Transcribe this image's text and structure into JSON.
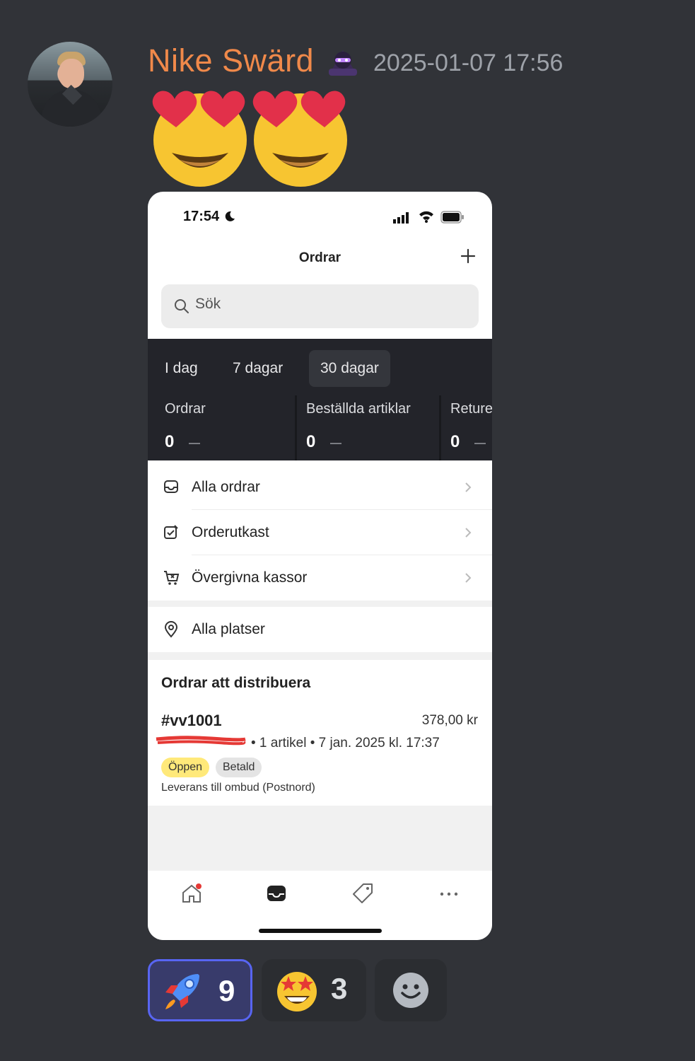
{
  "message": {
    "username": "Nike Swärd",
    "timestamp": "2025-01-07 17:56",
    "big_emojis": [
      "heart-eyes-emoji",
      "heart-eyes-emoji"
    ]
  },
  "phone": {
    "status_time": "17:54",
    "nav_title": "Ordrar",
    "search_placeholder": "Sök",
    "ranges": [
      "I dag",
      "7 dagar",
      "30 dagar"
    ],
    "active_range": "30 dagar",
    "stats": [
      {
        "label": "Ordrar",
        "value": "0"
      },
      {
        "label": "Beställda artiklar",
        "value": "0"
      },
      {
        "label": "Returer",
        "value": "0"
      }
    ],
    "menu": [
      {
        "label": "Alla ordrar",
        "icon": "inbox-icon"
      },
      {
        "label": "Orderutkast",
        "icon": "draft-edit-icon"
      },
      {
        "label": "Övergivna kassor",
        "icon": "abandoned-cart-icon"
      }
    ],
    "locations": {
      "label": "Alla platser",
      "icon": "location-pin-icon"
    },
    "section_title": "Ordrar att distribuera",
    "order": {
      "id": "#vv1001",
      "price": "378,00 kr",
      "meta": "• 1 artikel • 7 jan. 2025 kl. 17:37",
      "badges": [
        "Öppen",
        "Betald"
      ],
      "delivery": "Leverans till ombud (Postnord)"
    },
    "tabbar": [
      "home-icon",
      "orders-icon",
      "tag-icon",
      "more-icon"
    ]
  },
  "reactions": [
    {
      "emoji": "rocket-emoji",
      "count": "9",
      "active": true
    },
    {
      "emoji": "star-struck-emoji",
      "count": "3",
      "active": false
    },
    {
      "emoji": "add-reaction-icon",
      "count": "",
      "active": false
    }
  ],
  "colors": {
    "background": "#313338",
    "username": "#f0894a",
    "active_reaction_border": "#5865f2",
    "open_badge": "#ffe97a"
  }
}
